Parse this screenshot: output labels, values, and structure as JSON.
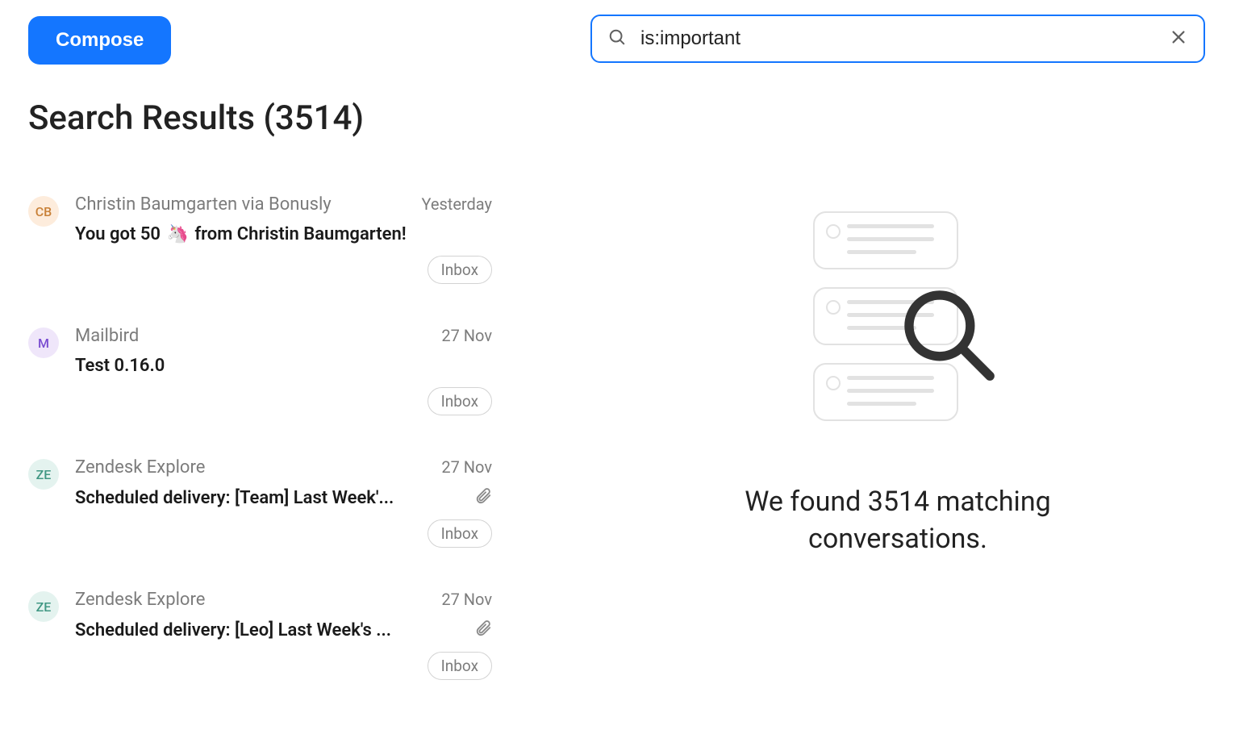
{
  "compose_label": "Compose",
  "results_title": "Search Results (3514)",
  "search_value": "is:important",
  "summary_text": "We found 3514 matching conversations.",
  "emails": [
    {
      "avatar_letters": "CB",
      "avatar_class": "cb",
      "sender": "Christin Baumgarten via Bonusly",
      "date": "Yesterday",
      "subject_prefix": "You got 50 ",
      "subject_emoji": "🦄",
      "subject_suffix": " from Christin Baumgarten!",
      "has_attachment": false,
      "label": "Inbox"
    },
    {
      "avatar_letters": "M",
      "avatar_class": "m",
      "sender": "Mailbird",
      "date": "27 Nov",
      "subject_prefix": "Test 0.16.0",
      "subject_emoji": "",
      "subject_suffix": "",
      "has_attachment": false,
      "label": "Inbox"
    },
    {
      "avatar_letters": "ZE",
      "avatar_class": "ze",
      "sender": "Zendesk Explore",
      "date": "27 Nov",
      "subject_prefix": "Scheduled delivery: [Team] Last Week'...",
      "subject_emoji": "",
      "subject_suffix": "",
      "has_attachment": true,
      "label": "Inbox"
    },
    {
      "avatar_letters": "ZE",
      "avatar_class": "ze",
      "sender": "Zendesk Explore",
      "date": "27 Nov",
      "subject_prefix": "Scheduled delivery: [Leo] Last Week's ...",
      "subject_emoji": "",
      "subject_suffix": "",
      "has_attachment": true,
      "label": "Inbox"
    }
  ]
}
